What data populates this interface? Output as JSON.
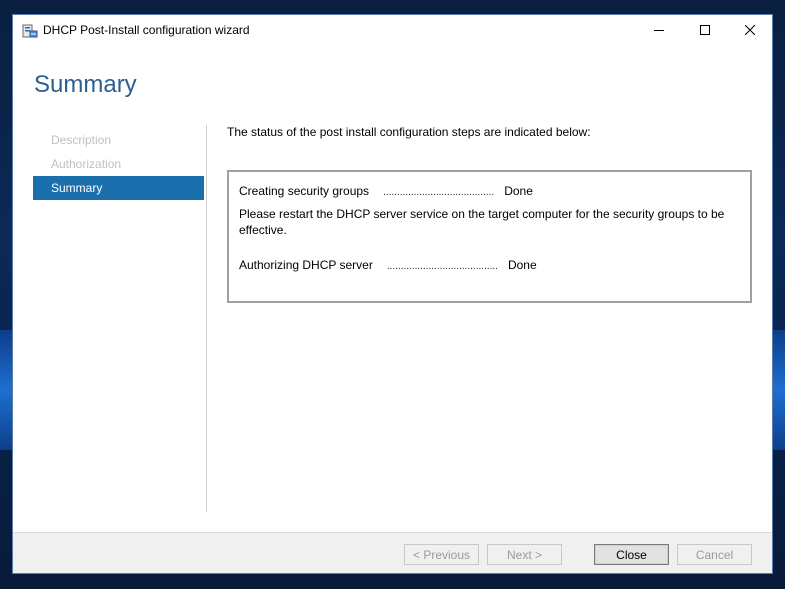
{
  "window": {
    "title": "DHCP Post-Install configuration wizard",
    "icon": "dhcp-server-icon"
  },
  "header": {
    "title": "Summary"
  },
  "nav": {
    "items": [
      {
        "label": "Description",
        "state": "disabled"
      },
      {
        "label": "Authorization",
        "state": "disabled"
      },
      {
        "label": "Summary",
        "state": "active"
      }
    ]
  },
  "content": {
    "intro": "The status of the post install configuration steps are indicated below:",
    "steps": [
      {
        "label": "Creating security groups",
        "dots": "........................................",
        "result": "Done",
        "message": "Please restart the DHCP server service on the target computer for the security groups to be effective."
      },
      {
        "label": "Authorizing DHCP server",
        "dots": "........................................",
        "result": "Done"
      }
    ]
  },
  "footer": {
    "previous": "< Previous",
    "next": "Next >",
    "close": "Close",
    "cancel": "Cancel"
  },
  "colors": {
    "accent": "#1b6fad",
    "header_text": "#2b5f8f",
    "footer_bg": "#f0f0f0"
  }
}
